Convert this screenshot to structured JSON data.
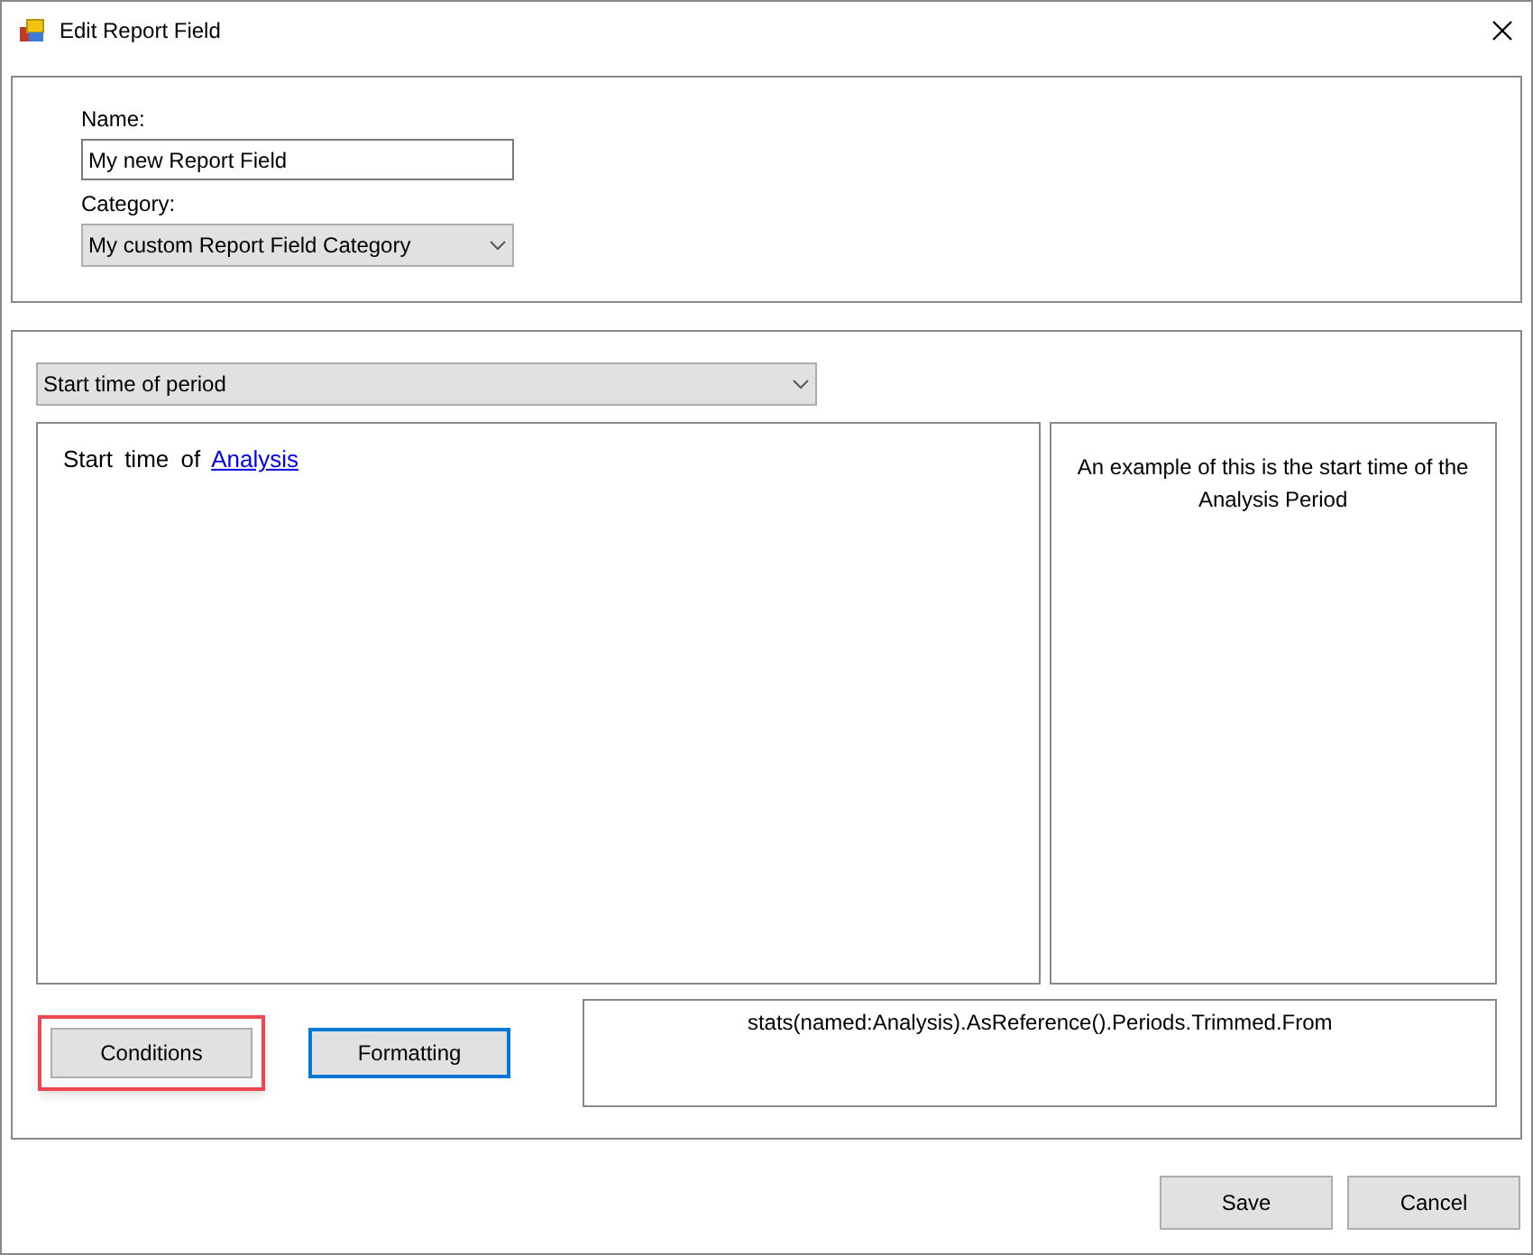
{
  "window": {
    "title": "Edit Report Field"
  },
  "name_field": {
    "label": "Name:",
    "value": "My new Report Field"
  },
  "category_field": {
    "label": "Category:",
    "value": "My custom Report Field Category"
  },
  "period_dropdown": {
    "value": "Start time of period"
  },
  "description": {
    "prefix": "Start time of",
    "link": "Analysis"
  },
  "example": {
    "text": "An example of this is the start time of the Analysis Period"
  },
  "buttons": [
    {
      "label": "Conditions",
      "highlighted": true,
      "focused": false
    },
    {
      "label": "Formatting",
      "highlighted": false,
      "focused": true
    }
  ],
  "expression": {
    "text": "stats(named:Analysis).AsReference().Periods.Trimmed.From"
  },
  "dialog_buttons": [
    "Save",
    "Cancel"
  ]
}
